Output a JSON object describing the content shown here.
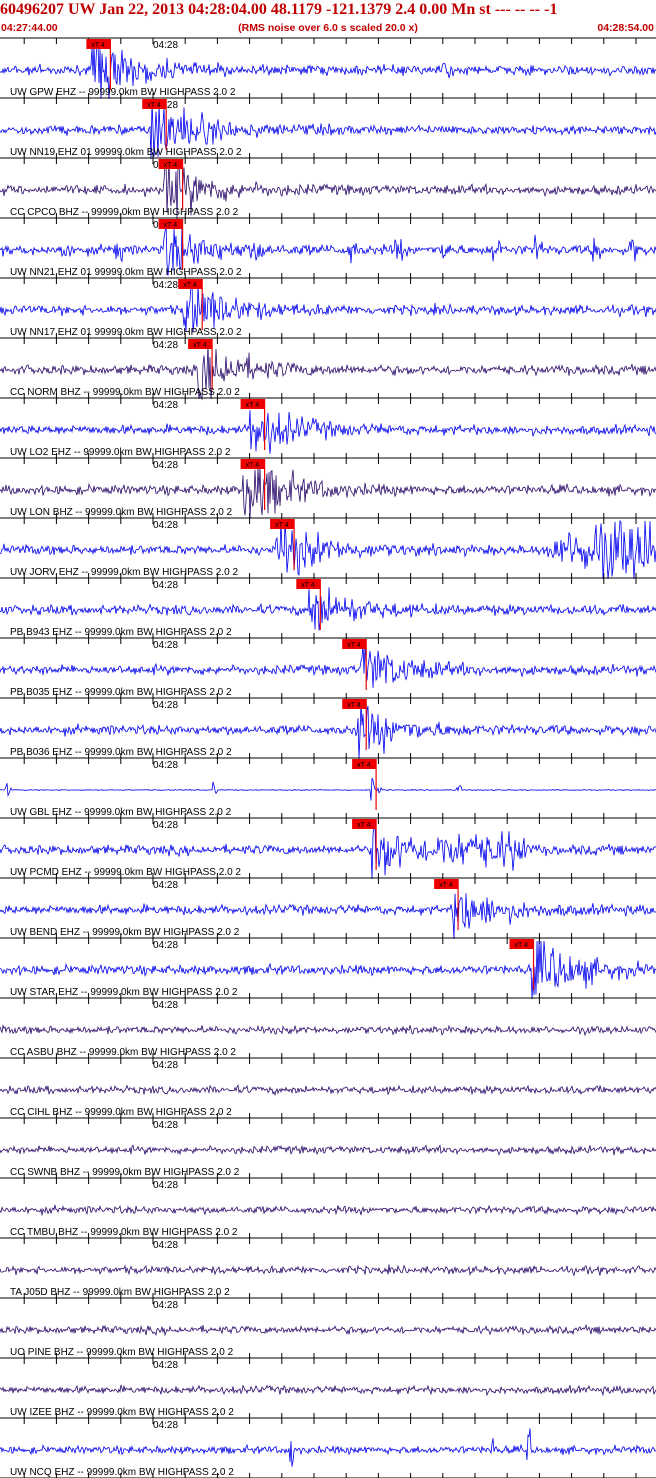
{
  "header": {
    "title": "60496207 UW Jan 22, 2013 04:28:04.00   48.1179 -121.1379  2.4 0.00 Mn st --- -- --   -1",
    "start_time": "04:27:44.00",
    "note": "(RMS noise over 6.0 s scaled 20.0 x)",
    "end_time": "04:28:54.00"
  },
  "time_tick_label": "04:28",
  "pick_label": "xT 4",
  "colors": {
    "trace_blue": "#0000ee",
    "trace_purple": "#2a0a6a",
    "pick_red": "#ee0000",
    "grid": "#000000"
  },
  "channels": [
    {
      "label": "UW GPW EHZ -- 99999.0km BW  HIGHPASS  2.0  2",
      "trace": "blue",
      "pick": 0.15,
      "arrival": 0.14,
      "amp": 1.4,
      "burst": 0.68
    },
    {
      "label": "UW NN19 EHZ 01 99999.0km BW  HIGHPASS  2.0  2",
      "trace": "blue",
      "pick": 0.235,
      "arrival": 0.23,
      "amp": 1.6
    },
    {
      "label": "CC CPCO BHZ -- 99999.0km BW  HIGHPASS  2.0  2",
      "trace": "purple",
      "pick": 0.26,
      "arrival": 0.25,
      "amp": 1.3
    },
    {
      "label": "UW NN21 EHZ 01 99999.0km BW  HIGHPASS  2.0  2",
      "trace": "blue",
      "pick": 0.26,
      "arrival": 0.25,
      "amp": 1.1,
      "spiky": true
    },
    {
      "label": "UW NN17 EHZ 01 99999.0km BW  HIGHPASS  2.0  2",
      "trace": "blue",
      "pick": 0.29,
      "arrival": 0.28,
      "amp": 1.3
    },
    {
      "label": "CC NORM BHZ -- 99999.0km BW  HIGHPASS  2.0  2",
      "trace": "purple",
      "pick": 0.305,
      "arrival": 0.3,
      "amp": 1.3
    },
    {
      "label": "UW LO2 EHZ -- 99999.0km BW  HIGHPASS  2.0  2",
      "trace": "blue",
      "pick": 0.385,
      "arrival": 0.38,
      "amp": 1.2
    },
    {
      "label": "UW LON BHZ -- 99999.0km BW  HIGHPASS  2.0  2",
      "trace": "purple",
      "pick": 0.385,
      "arrival": 0.37,
      "amp": 1.6
    },
    {
      "label": "UW JORV EHZ -- 99999.0km BW  HIGHPASS  2.0  2",
      "trace": "blue",
      "pick": 0.43,
      "arrival": 0.42,
      "amp": 1.3,
      "tail": 0.82
    },
    {
      "label": "PB B943 EHZ -- 99999.0km BW  HIGHPASS  2.0  2",
      "trace": "blue",
      "pick": 0.47,
      "arrival": 0.47,
      "amp": 1.1
    },
    {
      "label": "PB B035 EHZ -- 99999.0km BW  HIGHPASS  2.0  2",
      "trace": "blue",
      "pick": 0.54,
      "arrival": 0.55,
      "amp": 1.1
    },
    {
      "label": "PB B036 EHZ -- 99999.0km BW  HIGHPASS  2.0  2",
      "trace": "blue",
      "pick": 0.54,
      "arrival": 0.54,
      "amp": 1.1
    },
    {
      "label": "UW GBL EHZ -- 99999.0km BW  HIGHPASS  2.0  2",
      "trace": "blue",
      "pick": 0.555,
      "arrival": 0.565,
      "amp": 0.6,
      "flat": true
    },
    {
      "label": "UW PCMD EHZ -- 99999.0km BW  HIGHPASS  2.0  2",
      "trace": "blue",
      "pick": 0.555,
      "arrival": 0.565,
      "amp": 1.3,
      "burst2": 0.73
    },
    {
      "label": "UW BEND EHZ -- 99999.0km BW  HIGHPASS  2.0  2",
      "trace": "blue",
      "pick": 0.68,
      "arrival": 0.69,
      "amp": 1.1
    },
    {
      "label": "UW STAR EHZ -- 99999.0km BW  HIGHPASS  2.0  2",
      "trace": "blue",
      "pick": 0.795,
      "arrival": 0.81,
      "amp": 1.5
    },
    {
      "label": "CC ASBU BHZ -- 99999.0km BW  HIGHPASS  2.0  2",
      "trace": "purple",
      "noise": true
    },
    {
      "label": "CC CIHL BHZ -- 99999.0km BW  HIGHPASS  2.0  2",
      "trace": "purple",
      "noise": true
    },
    {
      "label": "CC SWNB BHZ -- 99999.0km BW  HIGHPASS  2.0  2",
      "trace": "purple",
      "noise": true
    },
    {
      "label": "CC TMBU BHZ -- 99999.0km BW  HIGHPASS  2.0  2",
      "trace": "purple",
      "noise": true
    },
    {
      "label": "TA J05D BHZ -- 99999.0km BW  HIGHPASS  2.0  2",
      "trace": "purple",
      "noise": true
    },
    {
      "label": "UO PINE BHZ -- 99999.0km BW  HIGHPASS  2.0  2",
      "trace": "purple",
      "noise": true
    },
    {
      "label": "UW IZEE BHZ -- 99999.0km BW  HIGHPASS  2.0  2",
      "trace": "purple",
      "noise": true
    },
    {
      "label": "UW NCQ EHZ -- 99999.0km BW  HIGHPASS  2.0  2",
      "trace": "blue",
      "noise": true,
      "spikes": [
        0.445,
        0.75,
        0.805
      ]
    }
  ]
}
